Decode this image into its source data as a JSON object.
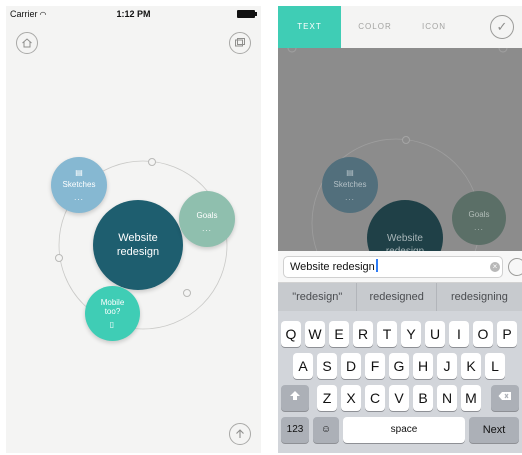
{
  "status_bar": {
    "carrier": "Carrier",
    "time": "1:12 PM"
  },
  "left_screen": {
    "icons": {
      "home": "home-icon",
      "screens": "screens-icon",
      "upload": "upload-arrow-icon"
    },
    "nodes": {
      "center": {
        "label": "Website redesign",
        "color": "#1e5e6f"
      },
      "sketches": {
        "label": "Sketches",
        "dots": "...",
        "color": "#86b8d2"
      },
      "goals": {
        "label": "Goals",
        "dots": "...",
        "color": "#8fbfae"
      },
      "mobile": {
        "label": "Mobile too?",
        "color": "#3fcdb5"
      }
    }
  },
  "right_screen": {
    "tabs": [
      {
        "label": "TEXT",
        "active": true
      },
      {
        "label": "COLOR",
        "active": false
      },
      {
        "label": "ICON",
        "active": false
      }
    ],
    "accent_color": "#3fcdb5",
    "dimmed_nodes": {
      "sketches": {
        "label": "Sketches",
        "dots": "..."
      },
      "center": {
        "label": "Website redesign"
      },
      "goals": {
        "label": "Goals",
        "dots": "..."
      }
    },
    "text_input": {
      "value": "Website redesign"
    },
    "suggestions": [
      "\"redesign\"",
      "redesigned",
      "redesigning"
    ],
    "keyboard": {
      "row1": [
        "Q",
        "W",
        "E",
        "R",
        "T",
        "Y",
        "U",
        "I",
        "O",
        "P"
      ],
      "row2": [
        "A",
        "S",
        "D",
        "F",
        "G",
        "H",
        "J",
        "K",
        "L"
      ],
      "row3": [
        "Z",
        "X",
        "C",
        "V",
        "B",
        "N",
        "M"
      ],
      "numbers_key": "123",
      "space_key": "space",
      "next_key": "Next"
    }
  }
}
